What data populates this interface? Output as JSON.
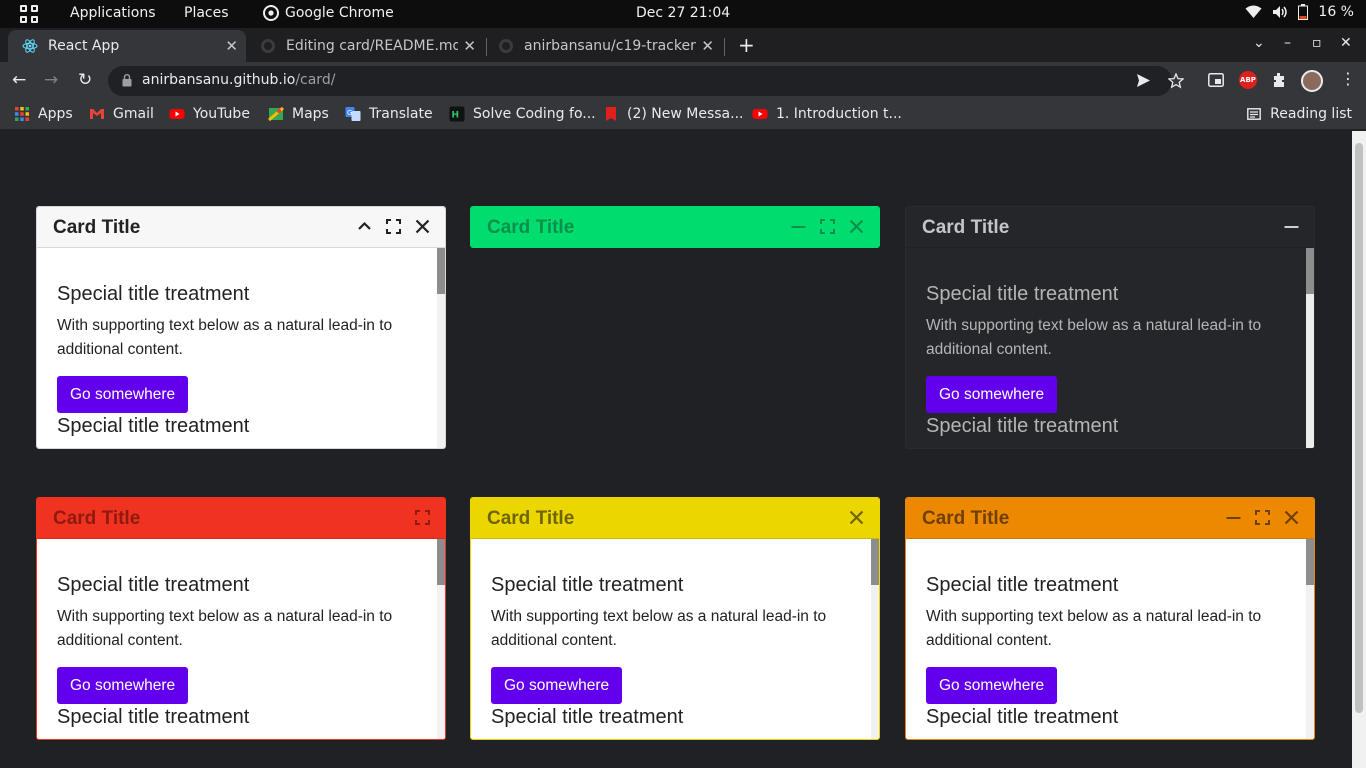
{
  "system_bar": {
    "applications": "Applications",
    "places": "Places",
    "active_app": "Google Chrome",
    "clock": "Dec 27  21:04",
    "battery": "16 %"
  },
  "tabs": [
    {
      "title": "React App",
      "active": true
    },
    {
      "title": "Editing card/README.md",
      "active": false
    },
    {
      "title": "anirbansanu/c19-tracker",
      "active": false
    }
  ],
  "address_bar": {
    "host": "anirbansanu.github.io",
    "path": "/card/"
  },
  "extension_abp": "ABP",
  "bookmarks": [
    {
      "label": "Apps",
      "icon": "apps-grid-icon",
      "color": "#ea4335"
    },
    {
      "label": "Gmail",
      "icon": "gmail-icon",
      "color": "#ea4335"
    },
    {
      "label": "YouTube",
      "icon": "youtube-icon",
      "color": "#ff0000"
    },
    {
      "label": "Maps",
      "icon": "maps-icon",
      "color": "#34a853"
    },
    {
      "label": "Translate",
      "icon": "translate-icon",
      "color": "#4285f4"
    },
    {
      "label": "Solve Coding fo...",
      "icon": "hackerrank-icon",
      "color": "#2ec866"
    },
    {
      "label": "(2) New Messa...",
      "icon": "messages-icon",
      "color": "#e0201f"
    },
    {
      "label": "1. Introduction t...",
      "icon": "youtube-icon",
      "color": "#ff0000"
    }
  ],
  "reading_list": "Reading list",
  "cards": [
    {
      "title": "Card Title",
      "theme": "light",
      "header_bg": "#f7f7f7",
      "title_color": "#222222",
      "border": "#d7d7d7",
      "actions": [
        "collapse",
        "maximize",
        "close"
      ],
      "collapsed": false,
      "subtitle": "Special title treatment",
      "text": "With supporting text below as a natural lead-in to additional content.",
      "button": "Go somewhere",
      "subtitle2": "Special title treatment"
    },
    {
      "title": "Card Title",
      "theme": "green",
      "header_bg": "#00dd6e",
      "title_color": "#0a8f4c",
      "border": "#00dd6e",
      "actions": [
        "minimize",
        "maximize",
        "close"
      ],
      "collapsed": true,
      "subtitle": "",
      "text": "",
      "button": "",
      "subtitle2": ""
    },
    {
      "title": "Card Title",
      "theme": "dark",
      "header_bg": "#252629",
      "title_color": "#c5c5c5",
      "border": "#2a2b2e",
      "actions": [
        "minimize"
      ],
      "collapsed": false,
      "subtitle": "Special title treatment",
      "text": "With supporting text below as a natural lead-in to additional content.",
      "button": "Go somewhere",
      "subtitle2": "Special title treatment"
    },
    {
      "title": "Card Title",
      "theme": "red",
      "header_bg": "#f03220",
      "title_color": "#8e1a10",
      "border": "#f03220",
      "actions": [
        "maximize"
      ],
      "collapsed": false,
      "subtitle": "Special title treatment",
      "text": "With supporting text below as a natural lead-in to additional content.",
      "button": "Go somewhere",
      "subtitle2": "Special title treatment"
    },
    {
      "title": "Card Title",
      "theme": "yellow",
      "header_bg": "#ecd600",
      "title_color": "#6f6500",
      "border": "#ecd600",
      "actions": [
        "close"
      ],
      "collapsed": false,
      "subtitle": "Special title treatment",
      "text": "With supporting text below as a natural lead-in to additional content.",
      "button": "Go somewhere",
      "subtitle2": "Special title treatment"
    },
    {
      "title": "Card Title",
      "theme": "orange",
      "header_bg": "#ec8900",
      "title_color": "#6f4000",
      "border": "#ec8900",
      "actions": [
        "minimize",
        "maximize",
        "close"
      ],
      "collapsed": false,
      "subtitle": "Special title treatment",
      "text": "With supporting text below as a natural lead-in to additional content.",
      "button": "Go somewhere",
      "subtitle2": "Special title treatment"
    }
  ]
}
